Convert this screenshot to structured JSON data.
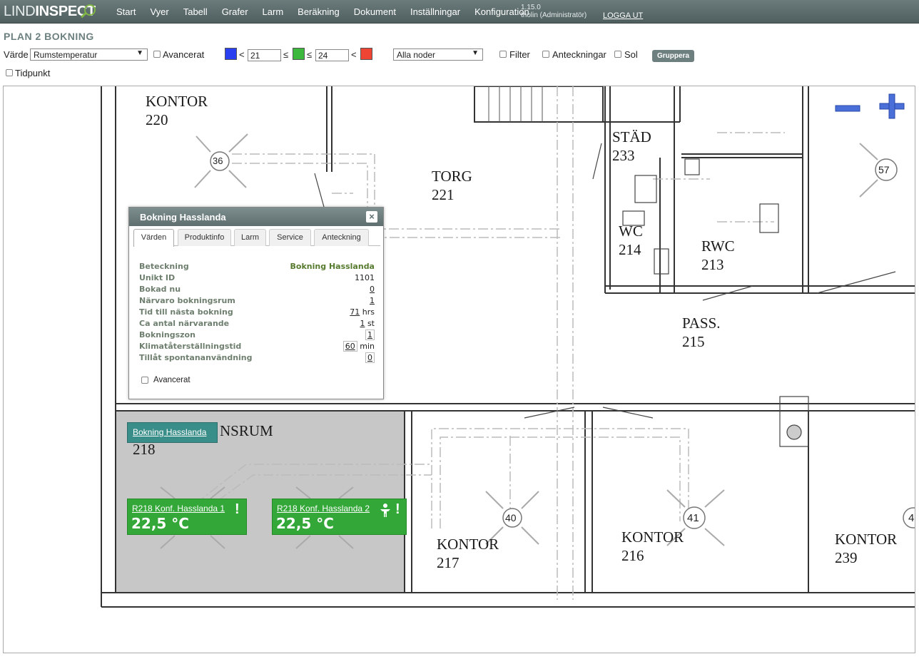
{
  "app": {
    "logo_light": "LIND",
    "logo_bold": "INSPECT",
    "version": "1.15.0",
    "user": "tholin (Administratör)",
    "logout": "LOGGA UT"
  },
  "nav": [
    "Start",
    "Vyer",
    "Tabell",
    "Grafer",
    "Larm",
    "Beräkning",
    "Dokument",
    "Inställningar",
    "Konfiguration"
  ],
  "page_title": "PLAN 2 BOKNING",
  "toolbar": {
    "value_label": "Värde",
    "value_select": "Rumstemperatur",
    "advanced": "Avancerat",
    "lt": "<",
    "le": "≤",
    "low": "21",
    "high": "24",
    "nodes_select": "Alla noder",
    "filter": "Filter",
    "notes": "Anteckningar",
    "sun": "Sol",
    "group_button": "Gruppera",
    "timepoint": "Tidpunkt",
    "colors": {
      "low": "#2a3ff0",
      "mid": "#3cb83c",
      "high": "#ee4433"
    }
  },
  "rooms": [
    {
      "name": "KONTOR",
      "num": "220"
    },
    {
      "name": "TORG",
      "num": "221"
    },
    {
      "name": "STÄD",
      "num": "233"
    },
    {
      "name": "WC",
      "num": "214"
    },
    {
      "name": "RWC",
      "num": "213"
    },
    {
      "name": "PASS.",
      "num": "215"
    },
    {
      "name": "NSRUM",
      "num": "218"
    },
    {
      "name": "KONTOR",
      "num": "217"
    },
    {
      "name": "KONTOR",
      "num": "216"
    },
    {
      "name": "KONTOR",
      "num": "239"
    }
  ],
  "diffusers": [
    "36",
    "57",
    "40",
    "41",
    "4"
  ],
  "popup": {
    "title": "Bokning Hasslanda",
    "close": "×",
    "tabs": [
      "Värden",
      "Produktinfo",
      "Larm",
      "Service",
      "Anteckning"
    ],
    "rows": [
      {
        "k": "Beteckning",
        "v": "Bokning Hasslanda"
      },
      {
        "k": "Unikt ID",
        "v": "1101"
      },
      {
        "k": "Bokad nu",
        "v": "0"
      },
      {
        "k": "Närvaro bokningsrum",
        "v": "1"
      },
      {
        "k": "Tid till nästa bokning",
        "v": "71",
        "unit": "hrs"
      },
      {
        "k": "Ca antal närvarande",
        "v": "1",
        "unit": "st"
      },
      {
        "k": "Bokningszon",
        "v": "1"
      },
      {
        "k": "Klimatåterställningstid",
        "v": "60",
        "unit": "min"
      },
      {
        "k": "Tillåt spontananvändning",
        "v": "0"
      }
    ],
    "advanced": "Avancerat"
  },
  "booking_tag": "Bokning Hasslanda",
  "sensors": [
    {
      "name": "R218 Konf. Hasslanda 1",
      "value": "22,5 °C"
    },
    {
      "name": "R218 Konf. Hasslanda 2",
      "value": "22,5 °C"
    }
  ]
}
